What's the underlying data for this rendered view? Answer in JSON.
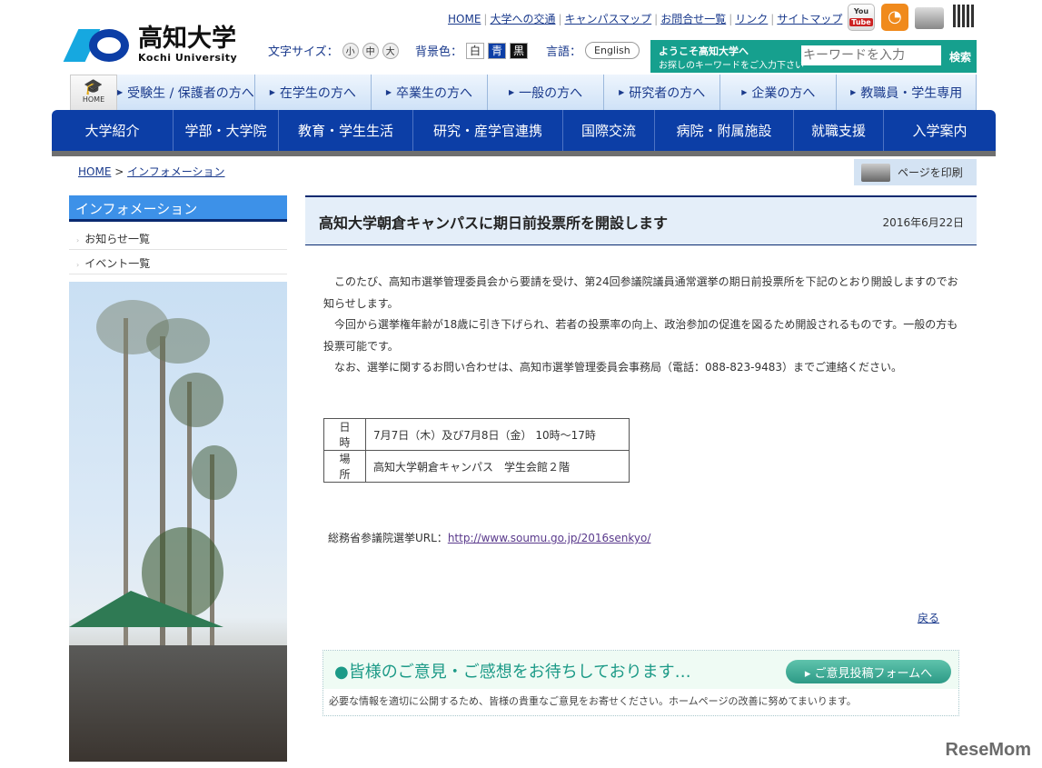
{
  "header": {
    "top_links": [
      "HOME",
      "大学への交通",
      "キャンパスマップ",
      "お問合せ一覧",
      "リンク",
      "サイトマップ"
    ],
    "logo_title": "高知大学",
    "logo_subtitle": "Kochi University",
    "font_size_label": "文字サイズ：",
    "font_sizes": [
      "小",
      "中",
      "大"
    ],
    "bg_label": "背景色：",
    "bg_options": [
      "白",
      "青",
      "黒"
    ],
    "lang_label": "言語：",
    "lang_button": "English",
    "search": {
      "welcome": "ようこそ高知大学へ",
      "hint": "お探しのキーワードをご入力下さい",
      "placeholder": "キーワードを入力",
      "button": "検索"
    },
    "icons": [
      "youtube-icon",
      "rss-icon",
      "print-icon",
      "qr-code-icon"
    ],
    "youtube_label": "You Tube"
  },
  "audience_nav": {
    "home": "HOME",
    "items": [
      "受験生 / 保護者の方へ",
      "在学生の方へ",
      "卒業生の方へ",
      "一般の方へ",
      "研究者の方へ",
      "企業の方へ",
      "教職員・学生専用"
    ]
  },
  "main_nav": [
    "大学紹介",
    "学部・大学院",
    "教育・学生生活",
    "研究・産学官連携",
    "国際交流",
    "病院・附属施設",
    "就職支援",
    "入学案内"
  ],
  "breadcrumb": [
    "HOME",
    "インフォメーション"
  ],
  "print_label": "ページを印刷",
  "sidebar": {
    "heading": "インフォメーション",
    "items": [
      "お知らせ一覧",
      "イベント一覧"
    ]
  },
  "article": {
    "title": "高知大学朝倉キャンパスに期日前投票所を開設します",
    "date": "2016年6月22日",
    "paragraphs": [
      "このたび、高知市選挙管理委員会から要請を受け、第24回参議院議員通常選挙の期日前投票所を下記のとおり開設しますのでお知らせします。",
      "今回から選挙権年齢が18歳に引き下げられ、若者の投票率の向上、政治参加の促進を図るため開設されるものです。一般の方も投票可能です。",
      "なお、選挙に関するお問い合わせは、高知市選挙管理委員会事務局（電話：088-823-9483）までご連絡ください。"
    ],
    "table": [
      {
        "key": "日　時",
        "value": "7月7日（木）及び7月8日（金） 10時～17時"
      },
      {
        "key": "場　所",
        "value": "高知大学朝倉キャンパス　学生会館２階"
      }
    ],
    "url_label": "総務省参議院選挙URL：",
    "url": "http://www.soumu.go.jp/2016senkyo/",
    "back": "戻る"
  },
  "feedback": {
    "heading": "●皆様のご意見・ご感想をお待ちしております…",
    "button": "▸ ご意見投稿フォームへ",
    "description": "必要な情報を適切に公開するため、皆様の貴重なご意見をお寄せください。ホームページの改善に努めてまいります。"
  },
  "watermark": "ReseMom"
}
